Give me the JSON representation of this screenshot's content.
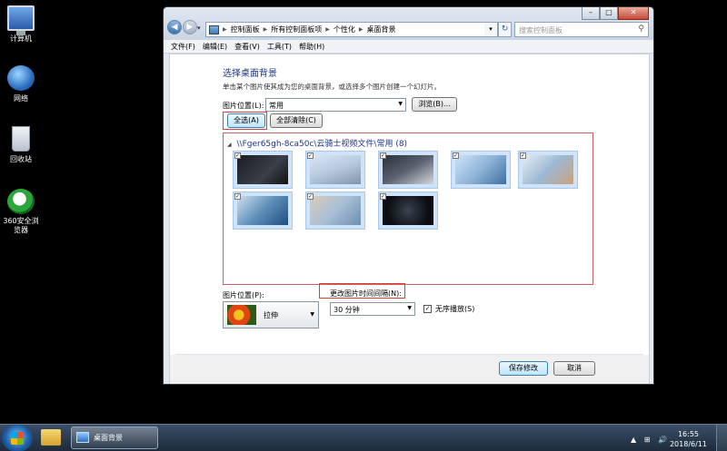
{
  "desktop": {
    "icons": [
      {
        "label": "计算机"
      },
      {
        "label": "网络"
      },
      {
        "label": "回收站"
      },
      {
        "label": "360安全浏览器"
      }
    ]
  },
  "window": {
    "nav": {
      "back": "◀",
      "forward": "▶",
      "dropdown": "▾"
    },
    "address": {
      "crumbs": [
        "控制面板",
        "所有控制面板项",
        "个性化",
        "桌面背景"
      ],
      "separator": "▶",
      "arrow": "▾",
      "refresh": "↻"
    },
    "search": {
      "placeholder": "搜索控制面板",
      "icon": "⚲"
    },
    "controls": {
      "minimize": "–",
      "maximize": "□",
      "close": "✕"
    },
    "menu": [
      "文件(F)",
      "编辑(E)",
      "查看(V)",
      "工具(T)",
      "帮助(H)"
    ],
    "heading": "选择桌面背景",
    "description": "单击某个图片使其成为您的桌面背景，或选择多个图片创建一个幻灯片。",
    "picture_location_label": "图片位置(L):",
    "picture_location_value": "常用",
    "browse_button": "浏览(B)...",
    "select_all_button": "全选(A)",
    "clear_all_button": "全部清除(C)",
    "gallery": {
      "header": "\\\\Fger65gh-8ca50c\\云骑士视频文件\\常用 (8)",
      "collapse_icon": "◢",
      "thumbnails": [
        {
          "theme": "dark",
          "checked": "✓"
        },
        {
          "theme": "laptop1",
          "checked": "✓"
        },
        {
          "theme": "laptop2",
          "checked": "✓"
        },
        {
          "theme": "hands1",
          "checked": "✓"
        },
        {
          "theme": "hands2",
          "checked": "✓"
        },
        {
          "theme": "laptop3",
          "checked": "✓"
        },
        {
          "theme": "office",
          "checked": "✓"
        },
        {
          "theme": "dark2",
          "checked": "✓"
        }
      ]
    },
    "picture_position_label": "图片位置(P):",
    "picture_position_value": "拉伸",
    "interval_label": "更改图片时间间隔(N):",
    "interval_value": "30 分钟",
    "shuffle_label": "无序播放(S)",
    "shuffle_checked": "✓",
    "save_button": "保存修改",
    "cancel_button": "取消"
  },
  "taskbar": {
    "task_label": "桌面背景",
    "tray_icons": "▲ ⊞ 🔊",
    "time": "16:55",
    "date": "2018/6/11"
  }
}
